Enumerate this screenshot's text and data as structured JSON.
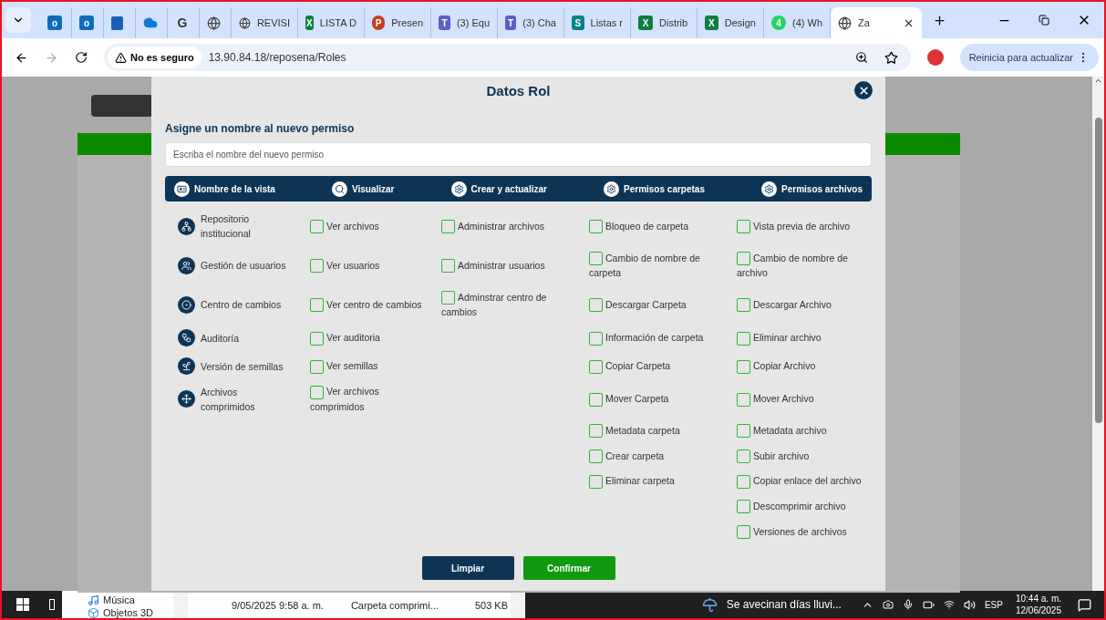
{
  "browser": {
    "tabs": [
      {
        "kind": "outlook",
        "glyph": "o",
        "selected": false
      },
      {
        "kind": "outlook",
        "glyph": "o",
        "selected": false
      },
      {
        "kind": "office",
        "selected": false
      },
      {
        "kind": "cloud",
        "selected": false
      },
      {
        "kind": "g",
        "glyph": "G",
        "selected": false
      },
      {
        "kind": "globe",
        "selected": false
      },
      {
        "kind": "globe",
        "label": "REVISI",
        "selected": false
      },
      {
        "kind": "excel",
        "glyph": "X",
        "label": "LISTA D",
        "selected": false
      },
      {
        "kind": "powerpoint",
        "glyph": "P",
        "label": "Presen",
        "selected": false
      },
      {
        "kind": "teams",
        "glyph": "T",
        "label": "(3) Equ",
        "selected": false
      },
      {
        "kind": "teams",
        "glyph": "T",
        "label": "(3) Cha",
        "selected": false
      },
      {
        "kind": "sharepoint",
        "glyph": "S",
        "label": "Listas r",
        "selected": false
      },
      {
        "kind": "excel",
        "glyph": "X",
        "label": "Distrib",
        "selected": false
      },
      {
        "kind": "excel",
        "glyph": "X",
        "label": "Design",
        "selected": false
      },
      {
        "kind": "whatsapp",
        "glyph": "4",
        "label": "(4) Wh",
        "selected": false
      },
      {
        "kind": "globe",
        "label": "Za",
        "selected": true
      }
    ],
    "security": "No es seguro",
    "url": "13.90.84.18/reposena/Roles",
    "update_button": "Reinicia para actualizar"
  },
  "modal": {
    "title": "Datos Rol",
    "name_label": "Asigne un nombre al nuevo permiso",
    "name_placeholder": "Escriba el nombre del nuevo permiso",
    "columns": [
      {
        "label": "Nombre de la vista",
        "kind": "card"
      },
      {
        "label": "Visualizar",
        "kind": "search"
      },
      {
        "label": "Crear y actualizar",
        "kind": "gear"
      },
      {
        "label": "Permisos carpetas",
        "kind": "gear"
      },
      {
        "label": "Permisos archivos",
        "kind": "gear"
      }
    ],
    "rows": [
      {
        "cells": [
          {
            "kind": "network",
            "label": "Repositorio institucional"
          },
          {
            "label": "Ver archivos",
            "checked": false
          },
          {
            "label": "Administrar archivos",
            "checked": false
          },
          {
            "label": "Bloqueo de carpeta",
            "checked": false
          },
          {
            "label": "Vista previa de archivo",
            "checked": false
          }
        ]
      },
      {
        "cells": [
          {
            "kind": "users",
            "label": "Gestión de usuarios"
          },
          {
            "label": "Ver usuarios",
            "checked": false
          },
          {
            "label": "Administrar usuarios",
            "checked": false
          },
          {
            "label": "Cambio de nombre de carpeta",
            "checked": false
          },
          {
            "label": "Cambio de nombre de archivo",
            "checked": false
          }
        ]
      },
      {
        "cells": [
          {
            "kind": "target",
            "label": "Centro de cambios"
          },
          {
            "label": "Ver centro de cambios",
            "checked": false
          },
          {
            "label": "Adminstrar centro de cambios",
            "checked": false
          },
          {
            "label": "Descargar Carpeta",
            "checked": false
          },
          {
            "label": "Descargar Archivo",
            "checked": false
          }
        ]
      },
      {
        "cells": [
          {
            "kind": "nodes",
            "label": "Auditoría"
          },
          {
            "label": "Ver auditoria",
            "checked": false
          },
          "",
          {
            "label": "Información de carpeta",
            "checked": false
          },
          {
            "label": "Eliminar archivo",
            "checked": false
          }
        ]
      },
      {
        "cells": [
          {
            "kind": "sprout",
            "label": "Versión de semillas"
          },
          {
            "label": "Ver semillas",
            "checked": false
          },
          "",
          {
            "label": "Copiar Carpeta",
            "checked": false
          },
          {
            "label": "Copiar Archivo",
            "checked": false
          }
        ]
      },
      {
        "cells": [
          {
            "kind": "arrows",
            "label": "Archivos comprimidos"
          },
          {
            "label": "Ver archivos comprimidos",
            "checked": false
          },
          "",
          {
            "label": "Mover Carpeta",
            "checked": false
          },
          {
            "label": "Mover Archivo",
            "checked": false
          }
        ]
      },
      {
        "cells": [
          "",
          "",
          "",
          {
            "label": "Metadata carpeta",
            "checked": false
          },
          {
            "label": "Metadata archivo",
            "checked": false
          }
        ]
      },
      {
        "cells": [
          "",
          "",
          "",
          {
            "label": "Crear carpeta",
            "checked": false
          },
          {
            "label": "Subir archivo",
            "checked": false
          }
        ]
      },
      {
        "cells": [
          "",
          "",
          "",
          {
            "label": "Eliminar carpeta",
            "checked": false
          },
          {
            "label": "Copiar enlace del archivo",
            "checked": false
          }
        ]
      },
      {
        "cells": [
          "",
          "",
          "",
          "",
          {
            "label": "Descomprimir archivo",
            "checked": false
          }
        ]
      },
      {
        "cells": [
          "",
          "",
          "",
          "",
          {
            "label": "Versiones de archivos",
            "checked": false
          }
        ]
      }
    ],
    "buttons": [
      {
        "label": "Limpiar",
        "kind": "secondary"
      },
      {
        "label": "Confirmar",
        "kind": "primary"
      }
    ]
  },
  "explorer": {
    "nav": [
      "Música",
      "Objetos 3D"
    ],
    "file": {
      "date": "9/05/2025 9:58 a. m.",
      "type": "Carpeta comprimi...",
      "size": "503 KB"
    }
  },
  "taskbar": {
    "weather": "Se avecinan días lluvi...",
    "language": "ESP",
    "time": "10:44 a. m.",
    "date": "12/06/2025"
  }
}
